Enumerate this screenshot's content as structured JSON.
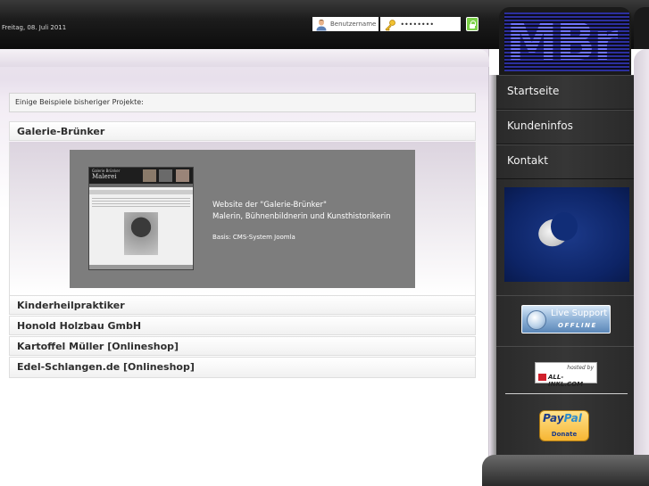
{
  "header": {
    "date": "Freitag, 08. Juli 2011",
    "username_placeholder": "Benutzername",
    "password_value": "••••••••"
  },
  "content": {
    "intro": "Einige Beispiele bisheriger Projekte:",
    "projects": [
      {
        "title": "Galerie-Brünker"
      },
      {
        "title": "Kinderheilpraktiker"
      },
      {
        "title": "Honold Holzbau GmbH"
      },
      {
        "title": "Kartoffel Müller [Onlineshop]"
      },
      {
        "title": "Edel-Schlangen.de [Onlineshop]"
      }
    ],
    "expanded": {
      "line1": "Website der \"Galerie-Brünker\"",
      "line2": "Malerin, Bühnenbildnerin und Kunsthistorikerin",
      "line3": "Basis: CMS-System Joomla",
      "thumb_small": "Galerie Brünker",
      "thumb_title": "Malerei"
    }
  },
  "sidebar": {
    "logo": "MBr",
    "menu": [
      {
        "label": "Startseite"
      },
      {
        "label": "Kundeninfos"
      },
      {
        "label": "Kontakt"
      }
    ],
    "live_support": {
      "title": "Live Support",
      "status": "OFFLINE"
    },
    "hosted": {
      "line1": "hosted by",
      "line2": "ALL-INKL.COM"
    },
    "paypal": {
      "brand_a": "Pay",
      "brand_b": "Pal",
      "action": "Donate"
    }
  },
  "icons": {
    "user": "user-icon",
    "key": "key-icon",
    "lock": "lock-icon"
  },
  "colors": {
    "topbar": "#1c1c1c",
    "sidebar": "#2f2f2f",
    "card": "#7d7d7d",
    "accent_blue": "#2c3199"
  }
}
